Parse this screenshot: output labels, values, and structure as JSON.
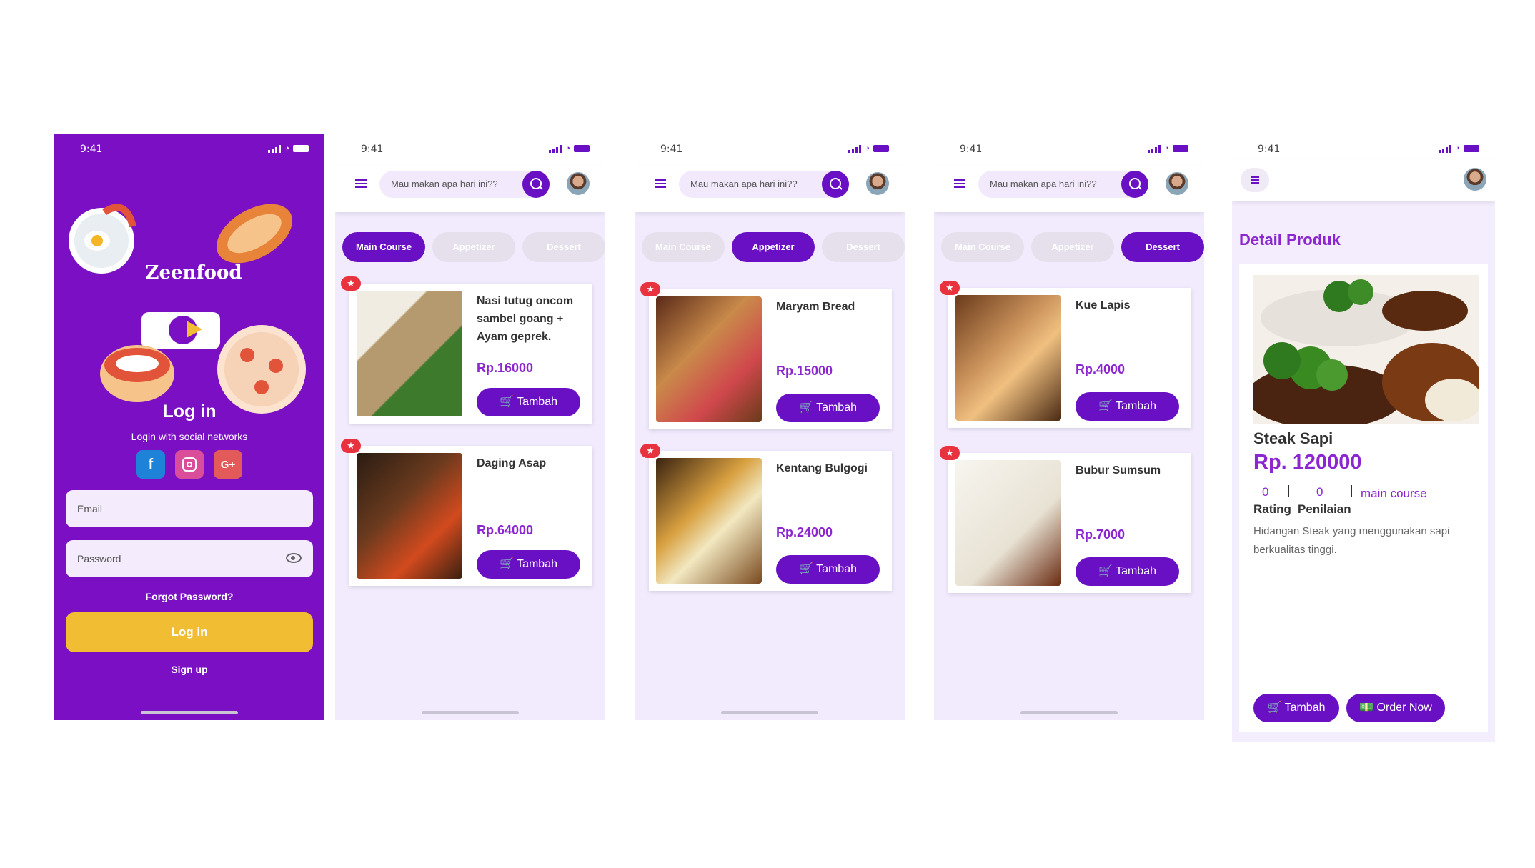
{
  "status_time": "9:41",
  "login": {
    "brand": "Zeenfood",
    "title": "Log in",
    "social_sub": "Login with social networks",
    "social": {
      "facebook": "f",
      "google": "G+"
    },
    "email_placeholder": "Email",
    "password_placeholder": "Password",
    "forgot": "Forgot Password?",
    "login_button": "Log in",
    "signup": "Sign up"
  },
  "search_placeholder": "Mau makan apa hari ini??",
  "tabs": [
    "Main Course",
    "Appetizer",
    "Dessert"
  ],
  "add_label": "Tambah",
  "screens": [
    {
      "active": 0,
      "items": [
        {
          "name": "Nasi tutug oncom sambel goang + Ayam geprek.",
          "price": "Rp.16000"
        },
        {
          "name": "Daging Asap",
          "price": "Rp.64000"
        }
      ]
    },
    {
      "active": 1,
      "items": [
        {
          "name": "Maryam Bread",
          "price": "Rp.15000"
        },
        {
          "name": "Kentang Bulgogi",
          "price": "Rp.24000"
        }
      ]
    },
    {
      "active": 2,
      "items": [
        {
          "name": "Kue Lapis",
          "price": "Rp.4000"
        },
        {
          "name": "Bubur Sumsum",
          "price": "Rp.7000"
        }
      ]
    }
  ],
  "detail": {
    "title": "Detail Produk",
    "name": "Steak Sapi",
    "price": "Rp. 120000",
    "rating": "0",
    "reviews": "0",
    "category": "main course",
    "rating_label": "Rating",
    "reviews_label": "Penilaian",
    "description": "Hidangan Steak yang menggunakan sapi berkualitas tinggi.",
    "add_button": "Tambah",
    "order_button": "Order Now"
  },
  "colors": {
    "primary": "#6a10c4",
    "accent": "#8b26d0",
    "login_bg": "#7a0fc4",
    "login_button": "#f0bd33",
    "star": "#e8323e"
  }
}
